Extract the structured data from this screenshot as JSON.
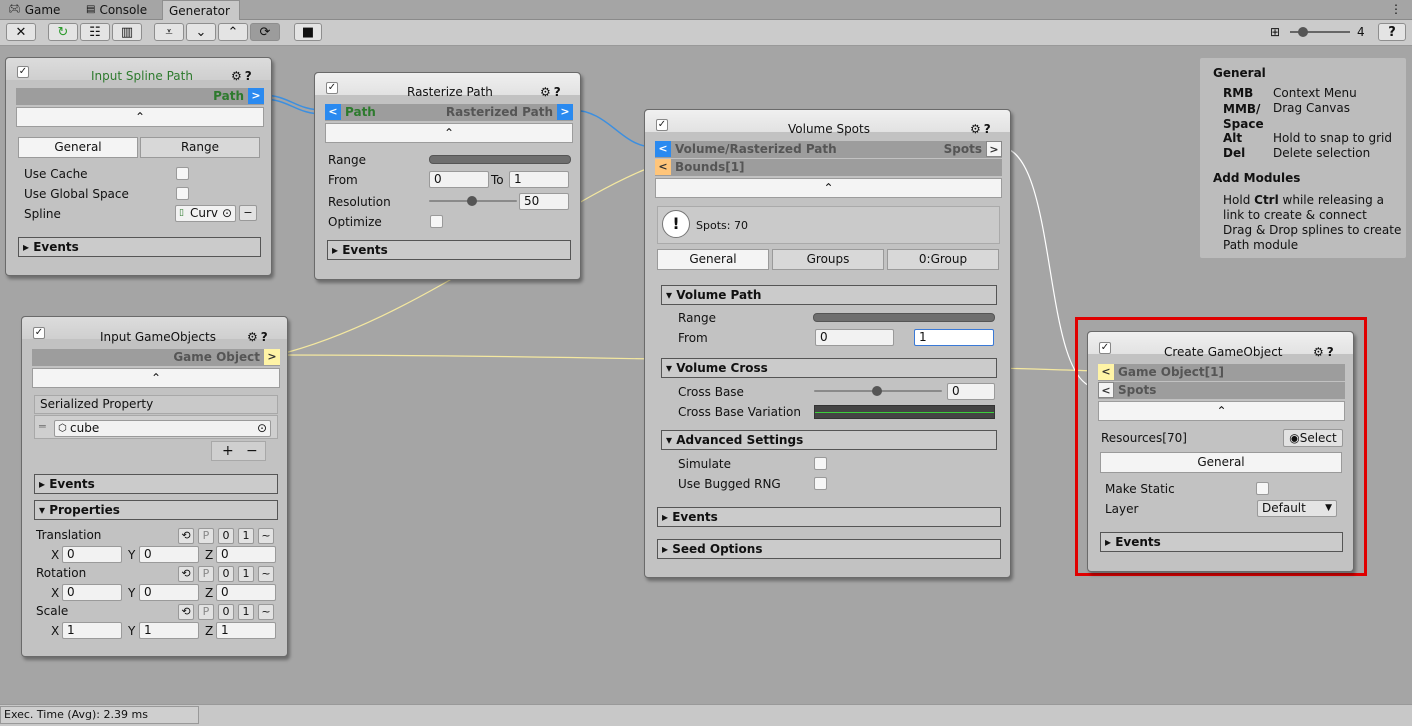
{
  "tabs": {
    "game": "Game",
    "console": "Console",
    "generator": "Generator"
  },
  "toolbar": {
    "zoom": "4"
  },
  "status": {
    "exec_time": "Exec. Time (Avg): 2.39 ms"
  },
  "help": {
    "general_title": "General",
    "rows": [
      {
        "k": "RMB",
        "v": "Context Menu"
      },
      {
        "k": "MMB/",
        "v": "Drag Canvas"
      },
      {
        "k": "Space",
        "v": ""
      },
      {
        "k": "Alt",
        "v": "Hold to snap to grid"
      },
      {
        "k": "Del",
        "v": "Delete selection"
      }
    ],
    "add_title": "Add Modules",
    "add_l1a": "Hold ",
    "add_l1b": "Ctrl",
    "add_l1c": " while releasing a",
    "add_l2": "link to create & connect",
    "add_l3": "Drag & Drop splines to create",
    "add_l4": "Path module"
  },
  "n1": {
    "title": "Input Spline Path",
    "out": "Path",
    "out_arrow": ">",
    "tab_general": "General",
    "tab_range": "Range",
    "use_cache": "Use Cache",
    "use_global": "Use Global Space",
    "spline": "Spline",
    "spline_val": "Curv",
    "events": "Events"
  },
  "n2": {
    "title": "Rasterize Path",
    "in_arrow": "<",
    "in": "Path",
    "out": "Rasterized Path",
    "out_arrow": ">",
    "range": "Range",
    "from": "From",
    "from_val": "0",
    "to": "To",
    "to_val": "1",
    "resolution": "Resolution",
    "res_val": "50",
    "optimize": "Optimize",
    "events": "Events"
  },
  "n3": {
    "title": "Volume Spots",
    "in1_arrow": "<",
    "in1": "Volume/Rasterized Path",
    "out": "Spots",
    "out_arrow": ">",
    "in2_arrow": "<",
    "in2": "Bounds[1]",
    "spots_info": "Spots: 70",
    "tab_general": "General",
    "tab_groups": "Groups",
    "tab_group0": "0:Group",
    "vol_path": "Volume Path",
    "range": "Range",
    "from": "From",
    "from_val": "0",
    "to_val": "1",
    "vol_cross": "Volume Cross",
    "cross_base": "Cross Base",
    "cross_base_val": "0",
    "cross_var": "Cross Base Variation",
    "adv": "Advanced Settings",
    "simulate": "Simulate",
    "bugged": "Use Bugged RNG",
    "events": "Events",
    "seed": "Seed Options"
  },
  "n4": {
    "title": "Input GameObjects",
    "out": "Game Object",
    "out_arrow": ">",
    "ser_prop": "Serialized Property",
    "item": "cube",
    "plus": "+",
    "minus": "−",
    "events": "Events",
    "props": "Properties",
    "translation": "Translation",
    "rotation": "Rotation",
    "scale": "Scale",
    "p": "P",
    "zero": "0",
    "one": "1",
    "tilde": "~",
    "x": "X",
    "y": "Y",
    "z": "Z",
    "t": [
      "0",
      "0",
      "0"
    ],
    "r": [
      "0",
      "0",
      "0"
    ],
    "s": [
      "1",
      "1",
      "1"
    ]
  },
  "n5": {
    "title": "Create GameObject",
    "in1_arrow": "<",
    "in1": "Game Object[1]",
    "in2_arrow": "<",
    "in2": "Spots",
    "resources": "Resources[70]",
    "select": "Select",
    "tab_general": "General",
    "make_static": "Make Static",
    "layer": "Layer",
    "layer_val": "Default",
    "events": "Events"
  },
  "colors": {
    "selection": "#e00000",
    "wire_blue": "#3c8fe0",
    "wire_yellow": "#f4e8a0",
    "wire_white": "#ffffff"
  }
}
